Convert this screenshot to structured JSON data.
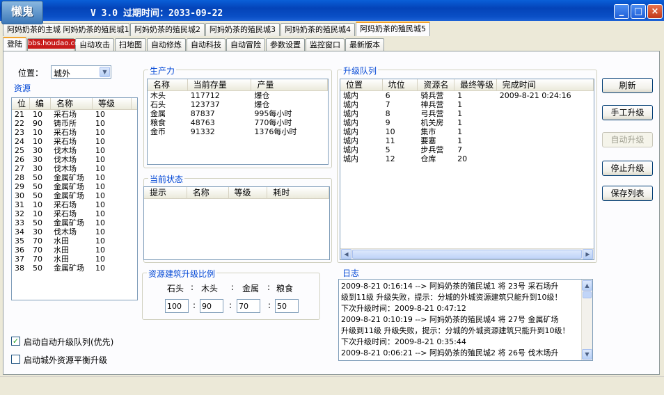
{
  "window": {
    "logo_text": "懒鬼",
    "logo_sub": "bbs.houdao.com",
    "title": "V 3.0  过期时间：2033-09-22",
    "controls": [
      "_",
      "□",
      "×"
    ]
  },
  "colony_tabs": [
    "阿妈奶茶的殖民城1",
    "阿妈奶茶的殖民城2",
    "阿妈奶茶的殖民城3",
    "阿妈奶茶的殖民城4",
    "阿妈奶茶的殖民城5"
  ],
  "colony_first": "阿妈奶茶的主城",
  "func_tabs": [
    "登陆",
    "",
    "自动攻击",
    "扫地图",
    "自动修炼",
    "自动科技",
    "自动冒险",
    "参数设置",
    "监控窗口",
    "最新版本"
  ],
  "location": {
    "label": "位置：",
    "value": "城外"
  },
  "resources": {
    "title": "资源",
    "columns": [
      "位",
      "编",
      "名称",
      "等级"
    ],
    "rows": [
      [
        "21",
        "10",
        "采石场",
        "10"
      ],
      [
        "22",
        "90",
        "铸币所",
        "10"
      ],
      [
        "23",
        "10",
        "采石场",
        "10"
      ],
      [
        "24",
        "10",
        "采石场",
        "10"
      ],
      [
        "25",
        "30",
        "伐木场",
        "10"
      ],
      [
        "26",
        "30",
        "伐木场",
        "10"
      ],
      [
        "27",
        "30",
        "伐木场",
        "10"
      ],
      [
        "28",
        "50",
        "金属矿场",
        "10"
      ],
      [
        "29",
        "50",
        "金属矿场",
        "10"
      ],
      [
        "30",
        "50",
        "金属矿场",
        "10"
      ],
      [
        "31",
        "10",
        "采石场",
        "10"
      ],
      [
        "32",
        "10",
        "采石场",
        "10"
      ],
      [
        "33",
        "50",
        "金属矿场",
        "10"
      ],
      [
        "34",
        "30",
        "伐木场",
        "10"
      ],
      [
        "35",
        "70",
        "水田",
        "10"
      ],
      [
        "36",
        "70",
        "水田",
        "10"
      ],
      [
        "37",
        "70",
        "水田",
        "10"
      ],
      [
        "38",
        "50",
        "金属矿场",
        "10"
      ]
    ]
  },
  "production": {
    "title": "生产力",
    "columns": [
      "名称",
      "当前存量",
      "产量"
    ],
    "rows": [
      [
        "木头",
        "117712",
        "爆仓"
      ],
      [
        "石头",
        "123737",
        "爆仓"
      ],
      [
        "金属",
        "87837",
        "995每小时"
      ],
      [
        "粮食",
        "48763",
        "770每小时"
      ],
      [
        "金币",
        "91332",
        "1376每小时"
      ]
    ]
  },
  "status": {
    "title": "当前状态",
    "columns": [
      "提示",
      "名称",
      "等级",
      "耗时"
    ]
  },
  "ratio": {
    "title": "资源建筑升级比例",
    "labels": [
      "石头",
      "木头",
      "金属",
      "粮食"
    ],
    "values": [
      "100",
      "90",
      "70",
      "50"
    ]
  },
  "queue": {
    "title": "升级队列",
    "columns": [
      "位置",
      "坑位",
      "资源名",
      "最终等级",
      "完成时间"
    ],
    "rows": [
      [
        "城内",
        "6",
        "骑兵营",
        "1",
        "2009-8-21 0:24:16"
      ],
      [
        "城内",
        "7",
        "神兵营",
        "1",
        ""
      ],
      [
        "城内",
        "8",
        "弓兵营",
        "1",
        ""
      ],
      [
        "城内",
        "9",
        "机关房",
        "1",
        ""
      ],
      [
        "城内",
        "10",
        "集市",
        "1",
        ""
      ],
      [
        "城内",
        "11",
        "要塞",
        "1",
        ""
      ],
      [
        "城内",
        "5",
        "步兵营",
        "7",
        ""
      ],
      [
        "城内",
        "12",
        "仓库",
        "20",
        ""
      ]
    ]
  },
  "buttons": {
    "refresh": "刷新",
    "manual": "手工升级",
    "auto": "自动升级",
    "stop": "停止升级",
    "save": "保存列表"
  },
  "log": {
    "title": "日志",
    "lines": [
      "2009-8-21 0:16:14 --> 阿妈奶茶的殖民城1 将 23号 采石场升",
      "级到11级 升级失败，提示：分城的外城资源建筑只能升到10级！",
      "下次升级时间：2009-8-21 0:47:12",
      "2009-8-21 0:10:19 --> 阿妈奶茶的殖民城4 将 27号 金属矿场",
      "升级到11级 升级失败，提示：分城的外城资源建筑只能升到10级！",
      "下次升级时间：2009-8-21 0:35:44",
      "2009-8-21 0:06:21 --> 阿妈奶茶的殖民城2 将 26号 伐木场升"
    ]
  },
  "checkboxes": {
    "auto_queue": {
      "label": "启动自动升级队列(优先)",
      "checked": true
    },
    "balance": {
      "label": "启动城外资源平衡升级",
      "checked": false
    }
  }
}
